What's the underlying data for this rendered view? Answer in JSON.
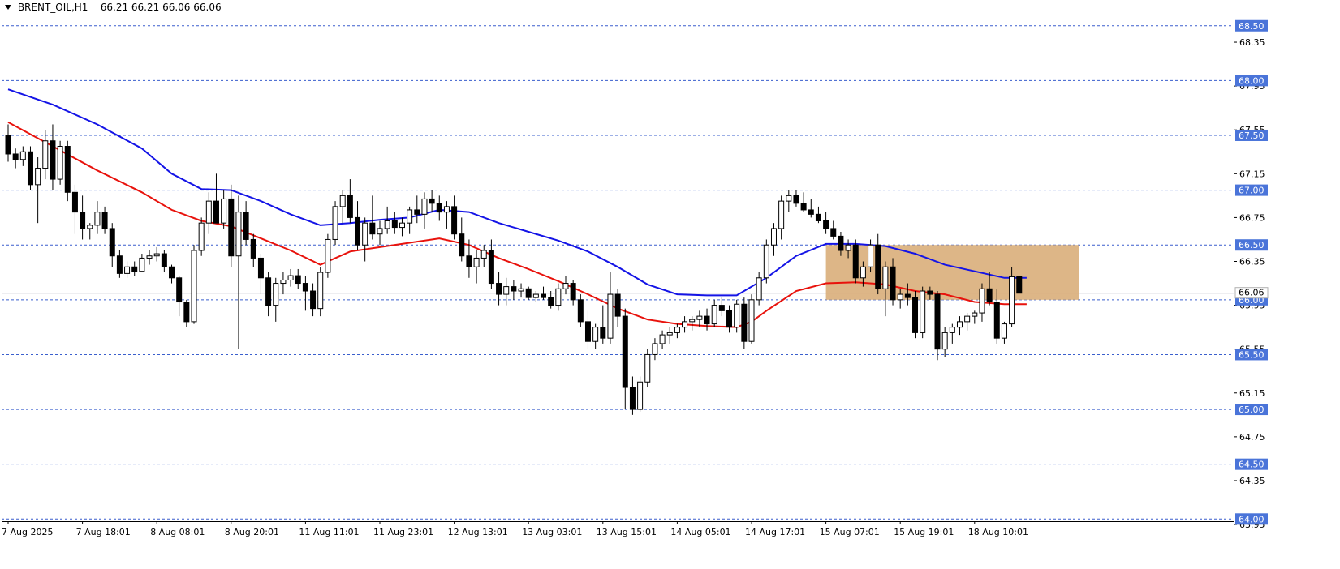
{
  "header": {
    "symbol_label": "BRENT_OIL,H1",
    "ohlc_text": "66.21 66.21 66.06 66.06"
  },
  "colors": {
    "background": "#ffffff",
    "axis": "#000000",
    "grid_level": "#3a5fcd",
    "level_label_bg": "#4a74d9",
    "ma_fast": "#e8120c",
    "ma_slow": "#1414e6",
    "zone_fill": "#d9ae7a",
    "bid_line": "#b9b9c8"
  },
  "chart_data": {
    "type": "candlestick",
    "symbol": "BRENT_OIL",
    "timeframe": "H1",
    "ylim": [
      63.98,
      68.72
    ],
    "y_ticks": [
      "68.35",
      "67.95",
      "67.55",
      "67.15",
      "66.75",
      "66.35",
      "65.95",
      "65.55",
      "65.15",
      "64.75",
      "64.35",
      "63.95"
    ],
    "levels": [
      "68.50",
      "68.00",
      "67.50",
      "67.00",
      "66.50",
      "66.00",
      "65.50",
      "65.00",
      "64.50",
      "64.00"
    ],
    "current_price": "66.06",
    "x_ticks": [
      {
        "label": "7 Aug 2025",
        "bar": 0
      },
      {
        "label": "7 Aug 18:01",
        "bar": 10
      },
      {
        "label": "8 Aug 08:01",
        "bar": 20
      },
      {
        "label": "8 Aug 20:01",
        "bar": 30
      },
      {
        "label": "11 Aug 11:01",
        "bar": 40
      },
      {
        "label": "11 Aug 23:01",
        "bar": 50
      },
      {
        "label": "12 Aug 13:01",
        "bar": 60
      },
      {
        "label": "13 Aug 03:01",
        "bar": 70
      },
      {
        "label": "13 Aug 15:01",
        "bar": 80
      },
      {
        "label": "14 Aug 05:01",
        "bar": 90
      },
      {
        "label": "14 Aug 17:01",
        "bar": 100
      },
      {
        "label": "15 Aug 07:01",
        "bar": 110
      },
      {
        "label": "15 Aug 19:01",
        "bar": 120
      },
      {
        "label": "18 Aug 10:01",
        "bar": 130
      }
    ],
    "zone": {
      "from_bar": 110,
      "to_bar": 144,
      "high": 66.5,
      "low": 66.0
    },
    "candles": [
      [
        67.5,
        67.6,
        67.26,
        67.33
      ],
      [
        67.33,
        67.38,
        67.2,
        67.28
      ],
      [
        67.28,
        67.4,
        67.22,
        67.35
      ],
      [
        67.35,
        67.4,
        67.0,
        67.05
      ],
      [
        67.05,
        67.3,
        66.7,
        67.2
      ],
      [
        67.2,
        67.55,
        67.1,
        67.45
      ],
      [
        67.45,
        67.6,
        67.0,
        67.1
      ],
      [
        67.1,
        67.45,
        67.05,
        67.4
      ],
      [
        67.4,
        67.45,
        66.9,
        66.98
      ],
      [
        66.98,
        67.05,
        66.6,
        66.8
      ],
      [
        66.8,
        66.95,
        66.55,
        66.65
      ],
      [
        66.65,
        66.7,
        66.55,
        66.68
      ],
      [
        66.68,
        66.9,
        66.6,
        66.8
      ],
      [
        66.8,
        66.85,
        66.6,
        66.65
      ],
      [
        66.65,
        66.7,
        66.3,
        66.4
      ],
      [
        66.4,
        66.45,
        66.2,
        66.24
      ],
      [
        66.24,
        66.35,
        66.2,
        66.3
      ],
      [
        66.3,
        66.35,
        66.22,
        66.26
      ],
      [
        66.26,
        66.42,
        66.25,
        66.38
      ],
      [
        66.38,
        66.45,
        66.32,
        66.4
      ],
      [
        66.4,
        66.48,
        66.35,
        66.42
      ],
      [
        66.42,
        66.45,
        66.25,
        66.3
      ],
      [
        66.3,
        66.32,
        66.15,
        66.2
      ],
      [
        66.2,
        66.22,
        65.85,
        65.98
      ],
      [
        65.98,
        66.0,
        65.75,
        65.8
      ],
      [
        65.8,
        66.5,
        65.78,
        66.45
      ],
      [
        66.45,
        66.75,
        66.4,
        66.7
      ],
      [
        66.7,
        66.98,
        66.6,
        66.9
      ],
      [
        66.9,
        67.15,
        66.8,
        66.7
      ],
      [
        66.7,
        67.0,
        66.65,
        66.92
      ],
      [
        66.92,
        67.05,
        66.3,
        66.4
      ],
      [
        66.4,
        66.95,
        65.55,
        66.8
      ],
      [
        66.8,
        66.9,
        66.5,
        66.55
      ],
      [
        66.55,
        66.6,
        66.3,
        66.38
      ],
      [
        66.38,
        66.42,
        66.05,
        66.2
      ],
      [
        66.2,
        66.25,
        65.85,
        65.95
      ],
      [
        65.95,
        66.2,
        65.8,
        66.15
      ],
      [
        66.15,
        66.25,
        66.05,
        66.18
      ],
      [
        66.18,
        66.28,
        66.12,
        66.22
      ],
      [
        66.22,
        66.28,
        66.1,
        66.15
      ],
      [
        66.15,
        66.22,
        65.9,
        66.08
      ],
      [
        66.08,
        66.15,
        65.85,
        65.92
      ],
      [
        65.92,
        66.3,
        65.85,
        66.25
      ],
      [
        66.25,
        66.6,
        66.2,
        66.55
      ],
      [
        66.55,
        66.9,
        66.5,
        66.85
      ],
      [
        66.85,
        67.0,
        66.7,
        66.95
      ],
      [
        66.95,
        67.1,
        66.7,
        66.75
      ],
      [
        66.75,
        66.9,
        66.45,
        66.5
      ],
      [
        66.5,
        66.75,
        66.35,
        66.7
      ],
      [
        66.7,
        66.95,
        66.55,
        66.6
      ],
      [
        66.6,
        66.72,
        66.5,
        66.65
      ],
      [
        66.65,
        66.85,
        66.6,
        66.72
      ],
      [
        66.72,
        66.8,
        66.6,
        66.66
      ],
      [
        66.66,
        66.75,
        66.58,
        66.7
      ],
      [
        66.7,
        66.85,
        66.6,
        66.82
      ],
      [
        66.82,
        66.95,
        66.7,
        66.78
      ],
      [
        66.78,
        66.98,
        66.65,
        66.92
      ],
      [
        66.92,
        67.0,
        66.8,
        66.88
      ],
      [
        66.88,
        66.95,
        66.72,
        66.8
      ],
      [
        66.8,
        66.9,
        66.65,
        66.85
      ],
      [
        66.85,
        66.95,
        66.55,
        66.6
      ],
      [
        66.6,
        66.75,
        66.35,
        66.4
      ],
      [
        66.4,
        66.55,
        66.2,
        66.3
      ],
      [
        66.3,
        66.45,
        66.15,
        66.38
      ],
      [
        66.38,
        66.5,
        66.3,
        66.45
      ],
      [
        66.45,
        66.55,
        66.1,
        66.15
      ],
      [
        66.15,
        66.25,
        65.95,
        66.05
      ],
      [
        66.05,
        66.2,
        65.95,
        66.12
      ],
      [
        66.12,
        66.18,
        66.0,
        66.08
      ],
      [
        66.08,
        66.15,
        66.02,
        66.1
      ],
      [
        66.1,
        66.12,
        66.0,
        66.02
      ],
      [
        66.02,
        66.08,
        65.98,
        66.05
      ],
      [
        66.05,
        66.12,
        66.0,
        66.02
      ],
      [
        66.02,
        66.08,
        65.92,
        65.95
      ],
      [
        65.95,
        66.15,
        65.9,
        66.1
      ],
      [
        66.1,
        66.22,
        66.05,
        66.15
      ],
      [
        66.15,
        66.18,
        65.95,
        66.0
      ],
      [
        66.0,
        66.05,
        65.75,
        65.8
      ],
      [
        65.8,
        65.9,
        65.55,
        65.62
      ],
      [
        65.62,
        65.78,
        65.55,
        65.75
      ],
      [
        65.75,
        65.95,
        65.6,
        65.65
      ],
      [
        65.65,
        66.25,
        65.6,
        66.05
      ],
      [
        66.05,
        66.1,
        65.75,
        65.85
      ],
      [
        65.85,
        65.92,
        65.0,
        65.2
      ],
      [
        65.2,
        65.3,
        64.95,
        65.0
      ],
      [
        65.0,
        65.3,
        64.98,
        65.25
      ],
      [
        65.25,
        65.55,
        65.2,
        65.5
      ],
      [
        65.5,
        65.65,
        65.45,
        65.6
      ],
      [
        65.6,
        65.72,
        65.55,
        65.68
      ],
      [
        65.68,
        65.75,
        65.6,
        65.7
      ],
      [
        65.7,
        65.78,
        65.65,
        65.75
      ],
      [
        65.75,
        65.85,
        65.7,
        65.8
      ],
      [
        65.8,
        65.85,
        65.72,
        65.82
      ],
      [
        65.82,
        65.9,
        65.75,
        65.85
      ],
      [
        65.85,
        65.92,
        65.72,
        65.78
      ],
      [
        65.78,
        66.0,
        65.75,
        65.95
      ],
      [
        65.95,
        66.02,
        65.85,
        65.9
      ],
      [
        65.9,
        65.95,
        65.7,
        65.75
      ],
      [
        65.75,
        66.0,
        65.7,
        65.96
      ],
      [
        65.96,
        66.02,
        65.55,
        65.62
      ],
      [
        65.62,
        66.05,
        65.6,
        66.0
      ],
      [
        66.0,
        66.25,
        65.95,
        66.2
      ],
      [
        66.2,
        66.55,
        66.15,
        66.5
      ],
      [
        66.5,
        66.7,
        66.4,
        66.65
      ],
      [
        66.65,
        66.95,
        66.55,
        66.9
      ],
      [
        66.9,
        67.0,
        66.8,
        66.95
      ],
      [
        66.95,
        67.0,
        66.85,
        66.88
      ],
      [
        66.88,
        66.98,
        66.8,
        66.82
      ],
      [
        66.82,
        66.92,
        66.75,
        66.78
      ],
      [
        66.78,
        66.85,
        66.7,
        66.72
      ],
      [
        66.72,
        66.8,
        66.6,
        66.65
      ],
      [
        66.65,
        66.72,
        66.55,
        66.58
      ],
      [
        66.58,
        66.62,
        66.4,
        66.45
      ],
      [
        66.45,
        66.55,
        66.38,
        66.5
      ],
      [
        66.5,
        66.55,
        66.15,
        66.2
      ],
      [
        66.2,
        66.35,
        66.12,
        66.3
      ],
      [
        66.3,
        66.55,
        66.25,
        66.5
      ],
      [
        66.5,
        66.6,
        66.05,
        66.1
      ],
      [
        66.1,
        66.35,
        65.85,
        66.3
      ],
      [
        66.3,
        66.38,
        65.95,
        66.0
      ],
      [
        66.0,
        66.1,
        65.92,
        66.05
      ],
      [
        66.05,
        66.15,
        65.95,
        66.02
      ],
      [
        66.02,
        66.08,
        65.65,
        65.7
      ],
      [
        65.7,
        66.12,
        65.65,
        66.08
      ],
      [
        66.08,
        66.12,
        66.0,
        66.05
      ],
      [
        66.05,
        66.08,
        65.45,
        65.55
      ],
      [
        65.55,
        65.75,
        65.48,
        65.7
      ],
      [
        65.7,
        65.78,
        65.6,
        65.75
      ],
      [
        65.75,
        65.85,
        65.68,
        65.8
      ],
      [
        65.8,
        65.88,
        65.72,
        65.85
      ],
      [
        65.85,
        65.9,
        65.78,
        65.88
      ],
      [
        65.88,
        66.15,
        65.8,
        66.1
      ],
      [
        66.1,
        66.25,
        65.95,
        65.98
      ],
      [
        65.98,
        66.1,
        65.6,
        65.65
      ],
      [
        65.65,
        65.8,
        65.6,
        65.78
      ],
      [
        65.78,
        66.3,
        65.75,
        66.21
      ],
      [
        66.21,
        66.21,
        66.06,
        66.06
      ]
    ],
    "ma_fast": [
      [
        0,
        67.62
      ],
      [
        6,
        67.4
      ],
      [
        12,
        67.18
      ],
      [
        18,
        66.98
      ],
      [
        22,
        66.82
      ],
      [
        26,
        66.72
      ],
      [
        30,
        66.67
      ],
      [
        34,
        66.56
      ],
      [
        38,
        66.45
      ],
      [
        42,
        66.32
      ],
      [
        46,
        66.44
      ],
      [
        50,
        66.48
      ],
      [
        54,
        66.52
      ],
      [
        58,
        66.56
      ],
      [
        62,
        66.5
      ],
      [
        66,
        66.38
      ],
      [
        70,
        66.28
      ],
      [
        74,
        66.17
      ],
      [
        78,
        66.05
      ],
      [
        82,
        65.92
      ],
      [
        86,
        65.82
      ],
      [
        90,
        65.78
      ],
      [
        94,
        65.76
      ],
      [
        98,
        65.75
      ],
      [
        100,
        65.8
      ],
      [
        102,
        65.9
      ],
      [
        106,
        66.08
      ],
      [
        110,
        66.15
      ],
      [
        114,
        66.16
      ],
      [
        118,
        66.14
      ],
      [
        122,
        66.08
      ],
      [
        126,
        66.05
      ],
      [
        130,
        65.98
      ],
      [
        134,
        65.96
      ],
      [
        137,
        65.96
      ]
    ],
    "ma_slow": [
      [
        0,
        67.92
      ],
      [
        6,
        67.78
      ],
      [
        12,
        67.6
      ],
      [
        18,
        67.38
      ],
      [
        22,
        67.15
      ],
      [
        26,
        67.01
      ],
      [
        30,
        67.0
      ],
      [
        34,
        66.9
      ],
      [
        38,
        66.78
      ],
      [
        42,
        66.68
      ],
      [
        46,
        66.7
      ],
      [
        50,
        66.73
      ],
      [
        54,
        66.75
      ],
      [
        58,
        66.82
      ],
      [
        62,
        66.8
      ],
      [
        66,
        66.7
      ],
      [
        70,
        66.62
      ],
      [
        74,
        66.54
      ],
      [
        78,
        66.44
      ],
      [
        82,
        66.3
      ],
      [
        86,
        66.14
      ],
      [
        90,
        66.05
      ],
      [
        94,
        66.04
      ],
      [
        98,
        66.04
      ],
      [
        102,
        66.2
      ],
      [
        106,
        66.4
      ],
      [
        110,
        66.51
      ],
      [
        114,
        66.51
      ],
      [
        118,
        66.49
      ],
      [
        122,
        66.42
      ],
      [
        126,
        66.32
      ],
      [
        130,
        66.26
      ],
      [
        134,
        66.2
      ],
      [
        137,
        66.2
      ]
    ]
  }
}
